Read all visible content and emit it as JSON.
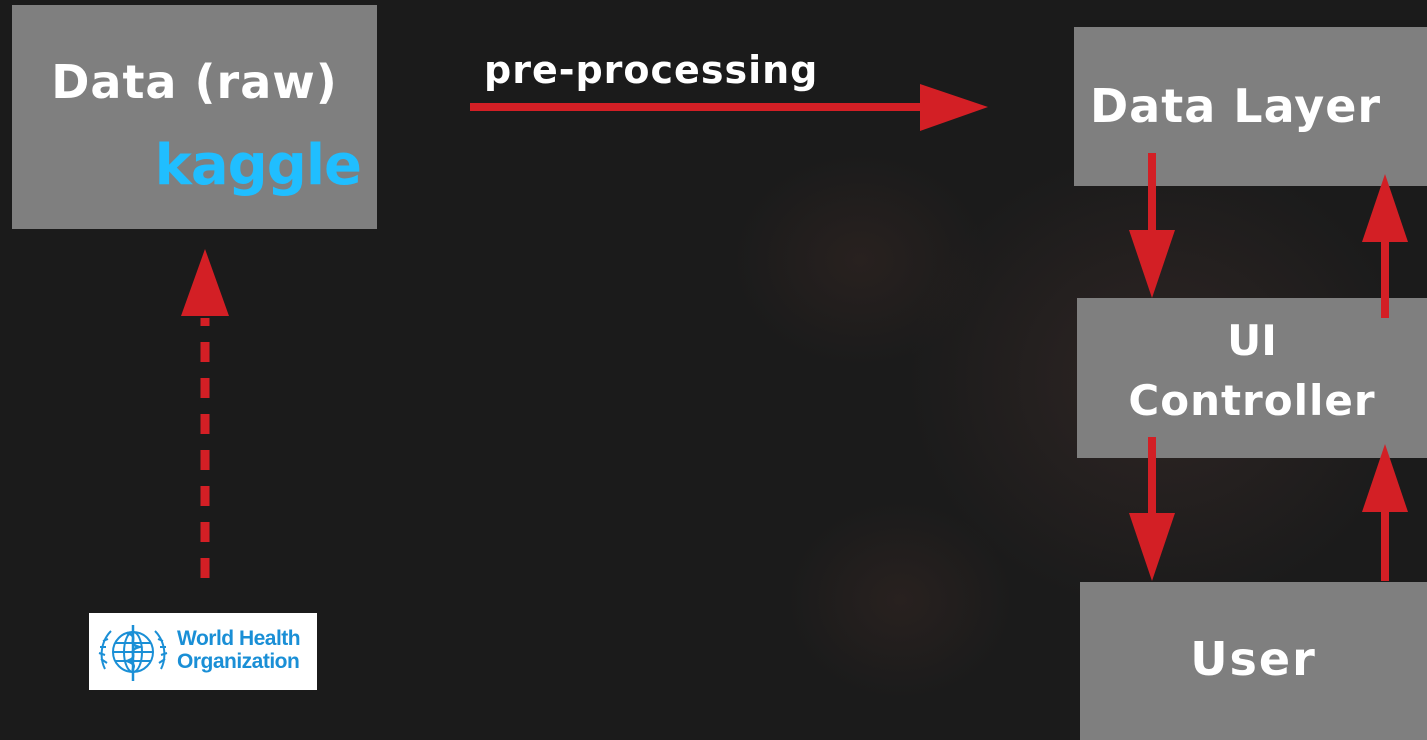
{
  "nodes": {
    "raw_data": {
      "title": "Data (raw)",
      "source_logo_text": "kaggle"
    },
    "data_layer": {
      "title": "Data Layer"
    },
    "ui_controller": {
      "line1": "UI",
      "line2": "Controller"
    },
    "user": {
      "title": "User"
    }
  },
  "edges": {
    "preprocessing": {
      "label": "pre-processing"
    }
  },
  "who_logo": {
    "line1": "World Health",
    "line2": "Organization"
  },
  "colors": {
    "background": "#1b1b1b",
    "box": "#7f7f7f",
    "arrow": "#d31f25",
    "kaggle": "#20beff",
    "who": "#1a8fd6"
  },
  "icons": {
    "kaggle_logo": "kaggle-logo",
    "who_logo": "world-health-organization-emblem"
  }
}
